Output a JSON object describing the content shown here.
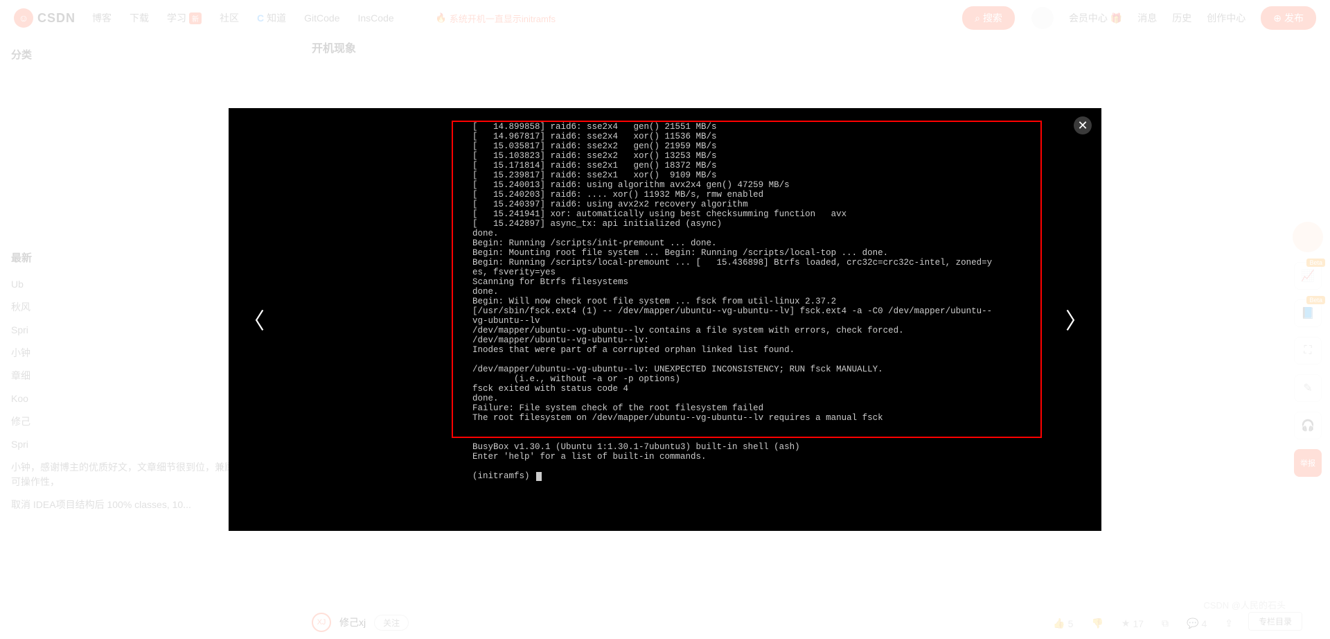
{
  "header": {
    "logo_text": "CSDN",
    "nav": [
      "博客",
      "下载",
      "学习",
      "社区",
      "知道",
      "GitCode",
      "InsCode"
    ],
    "new_tag": "新",
    "hot_prefix": "系统开机一直显示initramfs",
    "search_btn": "搜索",
    "right": [
      "会员中心",
      "消息",
      "历史",
      "创作中心"
    ],
    "publish": "发布"
  },
  "sidebar": {
    "cat_title": "分类",
    "latest_title": "最新",
    "items": [
      "Ub",
      "秋风",
      "Spri",
      "小钟",
      "章细",
      "Koo",
      "修己",
      "Spri",
      "小钟，感谢博主的优质好文，文章细节很到位，兼顾实用性和可操作性，",
      "取消 IDEA项目结构后 100% classes, 10..."
    ]
  },
  "article": {
    "section_title": "开机现象"
  },
  "author": {
    "avatar_text": "XJ",
    "name": "修己xj",
    "follow": "关注",
    "like": "5",
    "star": "17",
    "comment": "4",
    "column_btn": "专栏目录"
  },
  "watermark": "CSDN @人民的石头",
  "terminal": "[   14.899858] raid6: sse2x4   gen() 21551 MB/s\n[   14.967817] raid6: sse2x4   xor() 11536 MB/s\n[   15.035817] raid6: sse2x2   gen() 21959 MB/s\n[   15.103823] raid6: sse2x2   xor() 13253 MB/s\n[   15.171814] raid6: sse2x1   gen() 18372 MB/s\n[   15.239817] raid6: sse2x1   xor()  9109 MB/s\n[   15.240013] raid6: using algorithm avx2x4 gen() 47259 MB/s\n[   15.240203] raid6: .... xor() 11932 MB/s, rmw enabled\n[   15.240397] raid6: using avx2x2 recovery algorithm\n[   15.241941] xor: automatically using best checksumming function   avx\n[   15.242897] async_tx: api initialized (async)\ndone.\nBegin: Running /scripts/init-premount ... done.\nBegin: Mounting root file system ... Begin: Running /scripts/local-top ... done.\nBegin: Running /scripts/local-premount ... [   15.436898] Btrfs loaded, crc32c=crc32c-intel, zoned=y\nes, fsverity=yes\nScanning for Btrfs filesystems\ndone.\nBegin: Will now check root file system ... fsck from util-linux 2.37.2\n[/usr/sbin/fsck.ext4 (1) -- /dev/mapper/ubuntu--vg-ubuntu--lv] fsck.ext4 -a -C0 /dev/mapper/ubuntu--\nvg-ubuntu--lv\n/dev/mapper/ubuntu--vg-ubuntu--lv contains a file system with errors, check forced.\n/dev/mapper/ubuntu--vg-ubuntu--lv:\nInodes that were part of a corrupted orphan linked list found.\n\n/dev/mapper/ubuntu--vg-ubuntu--lv: UNEXPECTED INCONSISTENCY; RUN fsck MANUALLY.\n        (i.e., without -a or -p options)\nfsck exited with status code 4\ndone.\nFailure: File system check of the root filesystem failed\nThe root filesystem on /dev/mapper/ubuntu--vg-ubuntu--lv requires a manual fsck\n\n\nBusyBox v1.30.1 (Ubuntu 1:1.30.1-7ubuntu3) built-in shell (ash)\nEnter 'help' for a list of built-in commands.\n\n(initramfs) "
}
